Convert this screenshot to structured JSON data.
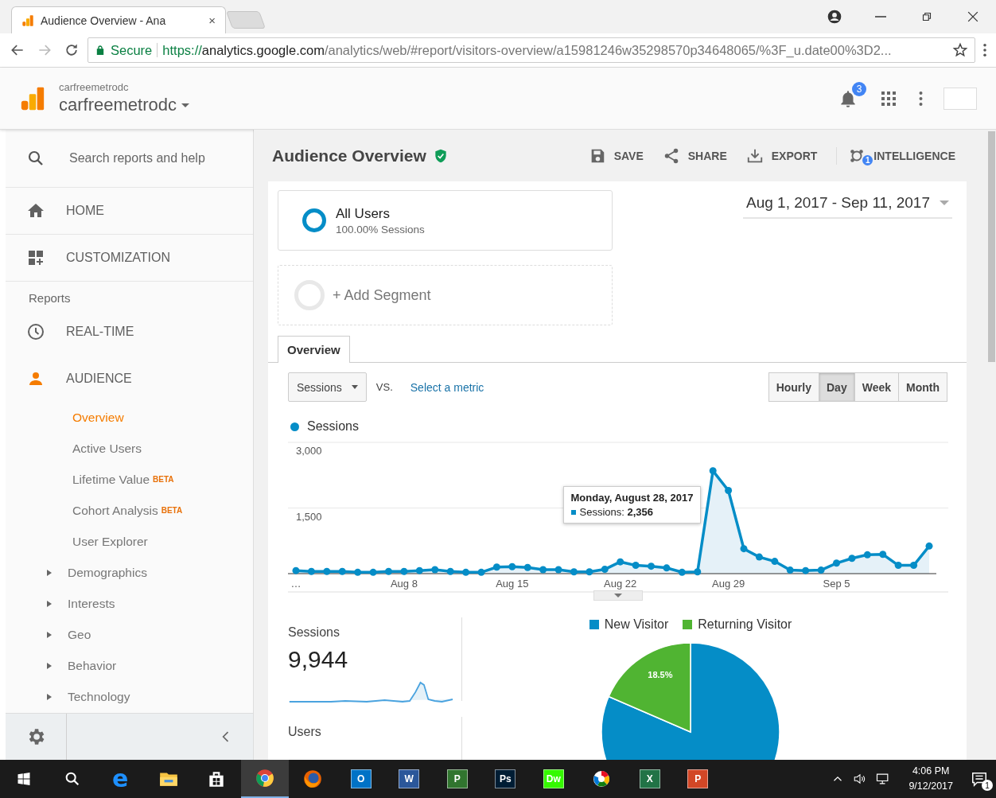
{
  "browser": {
    "tab_title": "Audience Overview - Ana",
    "tab_close": "×",
    "secure_label": "Secure",
    "url": {
      "scheme": "https://",
      "host": "analytics.google.com",
      "path": "/analytics/web/#report/visitors-overview/a15981246w35298570p34648065/%3F_u.date00%3D2..."
    }
  },
  "header": {
    "account": "carfreemetrodc",
    "property": "carfreemetrodc",
    "notifications": "3"
  },
  "sidebar": {
    "search_placeholder": "Search reports and help",
    "items": [
      {
        "kind": "nav",
        "label": "HOME",
        "selected": false
      },
      {
        "kind": "nav",
        "label": "CUSTOMIZATION",
        "selected": false
      },
      {
        "kind": "section",
        "label": "Reports"
      },
      {
        "kind": "nav",
        "label": "REAL-TIME",
        "selected": false
      },
      {
        "kind": "nav",
        "label": "AUDIENCE",
        "selected": true,
        "children": [
          {
            "label": "Overview",
            "selected": true
          },
          {
            "label": "Active Users",
            "selected": false
          },
          {
            "label": "Lifetime Value",
            "badge": "BETA",
            "selected": false
          },
          {
            "label": "Cohort Analysis",
            "badge": "BETA",
            "selected": false
          },
          {
            "label": "User Explorer",
            "selected": false
          },
          {
            "label": "Demographics",
            "selected": false,
            "expanded": false
          },
          {
            "label": "Interests",
            "selected": false,
            "expanded": false
          },
          {
            "label": "Geo",
            "selected": false,
            "expanded": false
          },
          {
            "label": "Behavior",
            "selected": false,
            "expanded": false
          },
          {
            "label": "Technology",
            "selected": false,
            "expanded": false
          }
        ]
      }
    ]
  },
  "main": {
    "title": "Audience Overview",
    "actions": [
      {
        "label": "SAVE"
      },
      {
        "label": "SHARE"
      },
      {
        "label": "EXPORT"
      },
      {
        "label": "INTELLIGENCE",
        "badge": "1"
      }
    ],
    "segments": [
      {
        "kind": "segment",
        "name": "All Users",
        "detail": "100.00% Sessions"
      },
      {
        "kind": "add",
        "name": "+ Add Segment"
      }
    ],
    "date_range": "Aug 1, 2017 - Sep 11, 2017",
    "tabs": [
      {
        "label": "Overview",
        "selected": true
      }
    ],
    "metric": "Sessions",
    "vs": "VS.",
    "compare_link": "Select a metric",
    "granularity": [
      {
        "label": "Hourly",
        "selected": false
      },
      {
        "label": "Day",
        "selected": true
      },
      {
        "label": "Week",
        "selected": false
      },
      {
        "label": "Month",
        "selected": false
      }
    ],
    "chart_data": {
      "type": "area",
      "categories": [
        "…",
        null,
        null,
        null,
        null,
        null,
        null,
        "Aug 8",
        null,
        null,
        null,
        null,
        null,
        null,
        "Aug 15",
        null,
        null,
        null,
        null,
        null,
        null,
        "Aug 22",
        null,
        null,
        null,
        null,
        null,
        null,
        "Aug 29",
        null,
        null,
        null,
        null,
        null,
        null,
        "Sep 5",
        null,
        null,
        null,
        null,
        null,
        null
      ],
      "series": [
        {
          "name": "Sessions",
          "color": "#058dc7",
          "values": [
            70,
            50,
            50,
            50,
            30,
            30,
            50,
            50,
            70,
            90,
            50,
            30,
            30,
            150,
            160,
            140,
            90,
            90,
            40,
            40,
            100,
            270,
            190,
            170,
            130,
            30,
            40,
            2350,
            1900,
            570,
            380,
            280,
            80,
            70,
            80,
            240,
            350,
            430,
            440,
            190,
            190,
            630
          ]
        }
      ],
      "ylim": [
        0,
        3000
      ],
      "yticks": [
        {
          "value": 1500,
          "label": "1,500"
        },
        {
          "value": 3000,
          "label": "3,000"
        }
      ]
    },
    "tooltip": {
      "title": "Monday, August 28, 2017",
      "text": "Sessions: **2,356**"
    },
    "metrics": [
      {
        "label": "Sessions",
        "value": "9,944"
      },
      {
        "label": "Users"
      }
    ],
    "pie": {
      "chart_data": {
        "type": "pie",
        "categories": [
          "New Visitor",
          "Returning Visitor"
        ],
        "series": [
          {
            "values": [
              81.5,
              18.5
            ]
          }
        ],
        "colors": [
          "#058dc7",
          "#50b432"
        ],
        "value_labels": [
          null,
          "18.5%"
        ]
      }
    }
  },
  "taskbar": {
    "apps": [
      {
        "kind": "start",
        "selected": false
      },
      {
        "kind": "search",
        "selected": false
      },
      {
        "kind": "edge",
        "glyph": "e",
        "selected": false
      },
      {
        "kind": "folder",
        "selected": false
      },
      {
        "kind": "store",
        "selected": false
      },
      {
        "kind": "chrome",
        "selected": true
      },
      {
        "kind": "firefox",
        "selected": false
      },
      {
        "kind": "tile",
        "glyph": "O",
        "color": "#0072c6",
        "selected": false
      },
      {
        "kind": "tile",
        "glyph": "W",
        "color": "#2b579a",
        "selected": false
      },
      {
        "kind": "tile",
        "glyph": "P",
        "color": "#31752f",
        "selected": false
      },
      {
        "kind": "tile",
        "glyph": "Ps",
        "color": "#001d34",
        "selected": false
      },
      {
        "kind": "tile",
        "glyph": "Dw",
        "color": "#35fa00",
        "selected": false
      },
      {
        "kind": "paint",
        "selected": false
      },
      {
        "kind": "tile",
        "glyph": "X",
        "color": "#217346",
        "selected": false
      },
      {
        "kind": "tile",
        "glyph": "P",
        "color": "#d24726",
        "selected": false
      }
    ],
    "time": "4:06 PM",
    "date": "9/12/2017",
    "notifications": "1"
  }
}
